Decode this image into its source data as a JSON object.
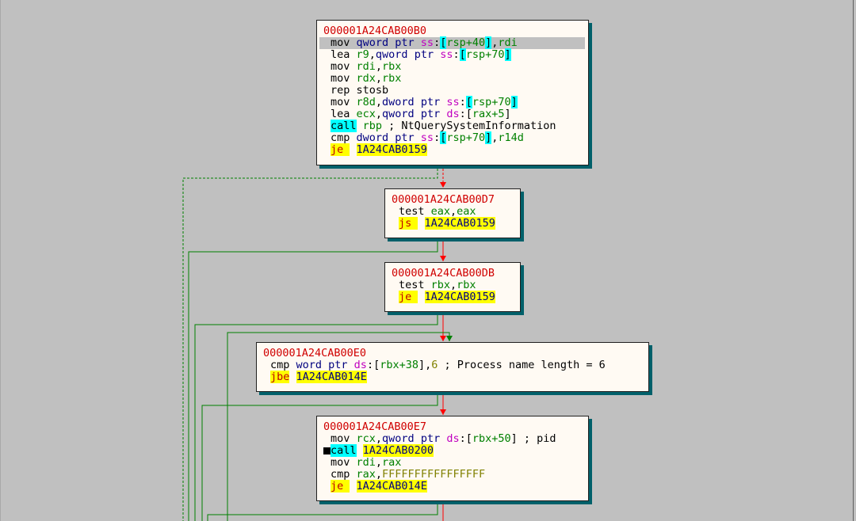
{
  "blocks": [
    {
      "id": "b0",
      "address": "000001A24CAB00B0",
      "lines": [
        {
          "highlight": true,
          "parts": [
            [
              "mn",
              "mov "
            ],
            [
              "kw",
              "qword ptr "
            ],
            [
              "seg",
              "ss"
            ],
            [
              "txt",
              ":"
            ],
            [
              "br",
              "["
            ],
            [
              "reg",
              "rsp+40"
            ],
            [
              "br",
              "]"
            ],
            [
              "txt",
              ","
            ],
            [
              "reg",
              "rdi"
            ]
          ]
        },
        {
          "parts": [
            [
              "mn",
              "lea "
            ],
            [
              "reg",
              "r9"
            ],
            [
              "txt",
              ","
            ],
            [
              "kw",
              "qword ptr "
            ],
            [
              "seg",
              "ss"
            ],
            [
              "txt",
              ":"
            ],
            [
              "br",
              "["
            ],
            [
              "reg",
              "rsp+70"
            ],
            [
              "br",
              "]"
            ]
          ]
        },
        {
          "parts": [
            [
              "mn",
              "mov "
            ],
            [
              "reg",
              "rdi"
            ],
            [
              "txt",
              ","
            ],
            [
              "reg",
              "rbx"
            ]
          ]
        },
        {
          "parts": [
            [
              "mn",
              "mov "
            ],
            [
              "reg",
              "rdx"
            ],
            [
              "txt",
              ","
            ],
            [
              "reg",
              "rbx"
            ]
          ]
        },
        {
          "parts": [
            [
              "mn",
              "rep stosb"
            ]
          ]
        },
        {
          "parts": [
            [
              "mn",
              "mov "
            ],
            [
              "reg",
              "r8d"
            ],
            [
              "txt",
              ","
            ],
            [
              "kw",
              "dword ptr "
            ],
            [
              "seg",
              "ss"
            ],
            [
              "txt",
              ":"
            ],
            [
              "br",
              "["
            ],
            [
              "reg",
              "rsp+70"
            ],
            [
              "br",
              "]"
            ]
          ]
        },
        {
          "parts": [
            [
              "mn",
              "lea "
            ],
            [
              "reg",
              "ecx"
            ],
            [
              "txt",
              ","
            ],
            [
              "kw",
              "qword ptr "
            ],
            [
              "seg",
              "ds"
            ],
            [
              "txt",
              ":"
            ],
            [
              "txt",
              "["
            ],
            [
              "reg",
              "rax+5"
            ],
            [
              "txt",
              "]"
            ]
          ]
        },
        {
          "parts": [
            [
              "br",
              "call"
            ],
            [
              "txt",
              " "
            ],
            [
              "reg",
              "rbp"
            ],
            [
              "cmt",
              " ; NtQuerySystemInformation"
            ]
          ]
        },
        {
          "parts": [
            [
              "mn",
              "cmp "
            ],
            [
              "kw",
              "dword ptr "
            ],
            [
              "seg",
              "ss"
            ],
            [
              "txt",
              ":"
            ],
            [
              "br",
              "["
            ],
            [
              "reg",
              "rsp+70"
            ],
            [
              "br",
              "]"
            ],
            [
              "txt",
              ","
            ],
            [
              "reg",
              "r14d"
            ]
          ]
        },
        {
          "parts": [
            [
              "jmp",
              "je "
            ],
            [
              "txt",
              " "
            ],
            [
              "target",
              "1A24CAB0159"
            ]
          ]
        }
      ]
    },
    {
      "id": "b1",
      "address": "000001A24CAB00D7",
      "lines": [
        {
          "parts": [
            [
              "mn",
              "test "
            ],
            [
              "reg",
              "eax"
            ],
            [
              "txt",
              ","
            ],
            [
              "reg",
              "eax"
            ]
          ]
        },
        {
          "parts": [
            [
              "jmp",
              "js "
            ],
            [
              "txt",
              " "
            ],
            [
              "target",
              "1A24CAB0159"
            ]
          ]
        }
      ]
    },
    {
      "id": "b2",
      "address": "000001A24CAB00DB",
      "lines": [
        {
          "parts": [
            [
              "mn",
              "test "
            ],
            [
              "reg",
              "rbx"
            ],
            [
              "txt",
              ","
            ],
            [
              "reg",
              "rbx"
            ]
          ]
        },
        {
          "parts": [
            [
              "jmp",
              "je "
            ],
            [
              "txt",
              " "
            ],
            [
              "target",
              "1A24CAB0159"
            ]
          ]
        }
      ]
    },
    {
      "id": "b3",
      "address": "000001A24CAB00E0",
      "lines": [
        {
          "parts": [
            [
              "mn",
              "cmp "
            ],
            [
              "kw",
              "word ptr "
            ],
            [
              "seg",
              "ds"
            ],
            [
              "txt",
              ":"
            ],
            [
              "txt",
              "["
            ],
            [
              "reg",
              "rbx+38"
            ],
            [
              "txt",
              "]"
            ],
            [
              "txt",
              ","
            ],
            [
              "num",
              "6"
            ],
            [
              "cmt",
              " ; Process name length = 6"
            ]
          ]
        },
        {
          "parts": [
            [
              "jmp",
              "jbe"
            ],
            [
              "txt",
              " "
            ],
            [
              "target",
              "1A24CAB014E"
            ]
          ]
        }
      ]
    },
    {
      "id": "b4",
      "address": "000001A24CAB00E7",
      "lines": [
        {
          "parts": [
            [
              "mn",
              "mov "
            ],
            [
              "reg",
              "rcx"
            ],
            [
              "txt",
              ","
            ],
            [
              "kw",
              "qword ptr "
            ],
            [
              "seg",
              "ds"
            ],
            [
              "txt",
              ":"
            ],
            [
              "txt",
              "["
            ],
            [
              "reg",
              "rbx+50"
            ],
            [
              "txt",
              "]"
            ],
            [
              "cmt",
              " ; pid"
            ]
          ]
        },
        {
          "breakpoint": true,
          "parts": [
            [
              "br",
              "call"
            ],
            [
              "txt",
              " "
            ],
            [
              "target",
              "1A24CAB0200"
            ]
          ]
        },
        {
          "parts": [
            [
              "mn",
              "mov "
            ],
            [
              "reg",
              "rdi"
            ],
            [
              "txt",
              ","
            ],
            [
              "reg",
              "rax"
            ]
          ]
        },
        {
          "parts": [
            [
              "mn",
              "cmp "
            ],
            [
              "reg",
              "rax"
            ],
            [
              "txt",
              ","
            ],
            [
              "num",
              "FFFFFFFFFFFFFFFF"
            ]
          ]
        },
        {
          "parts": [
            [
              "jmp",
              "je "
            ],
            [
              "txt",
              " "
            ],
            [
              "target",
              "1A24CAB014E"
            ]
          ]
        }
      ]
    }
  ],
  "colors": {
    "background": "#c0c0c0",
    "block_bg": "#fffaf3",
    "block_shadow": "#00606a",
    "address": "#d00000",
    "register": "#008000",
    "keyword": "#000080",
    "segment": "#c000c0",
    "number": "#808000",
    "branch_highlight": "#00ffff",
    "target_highlight": "#ffff00",
    "edge_false": "#ff0000",
    "edge_true": "#008000"
  }
}
